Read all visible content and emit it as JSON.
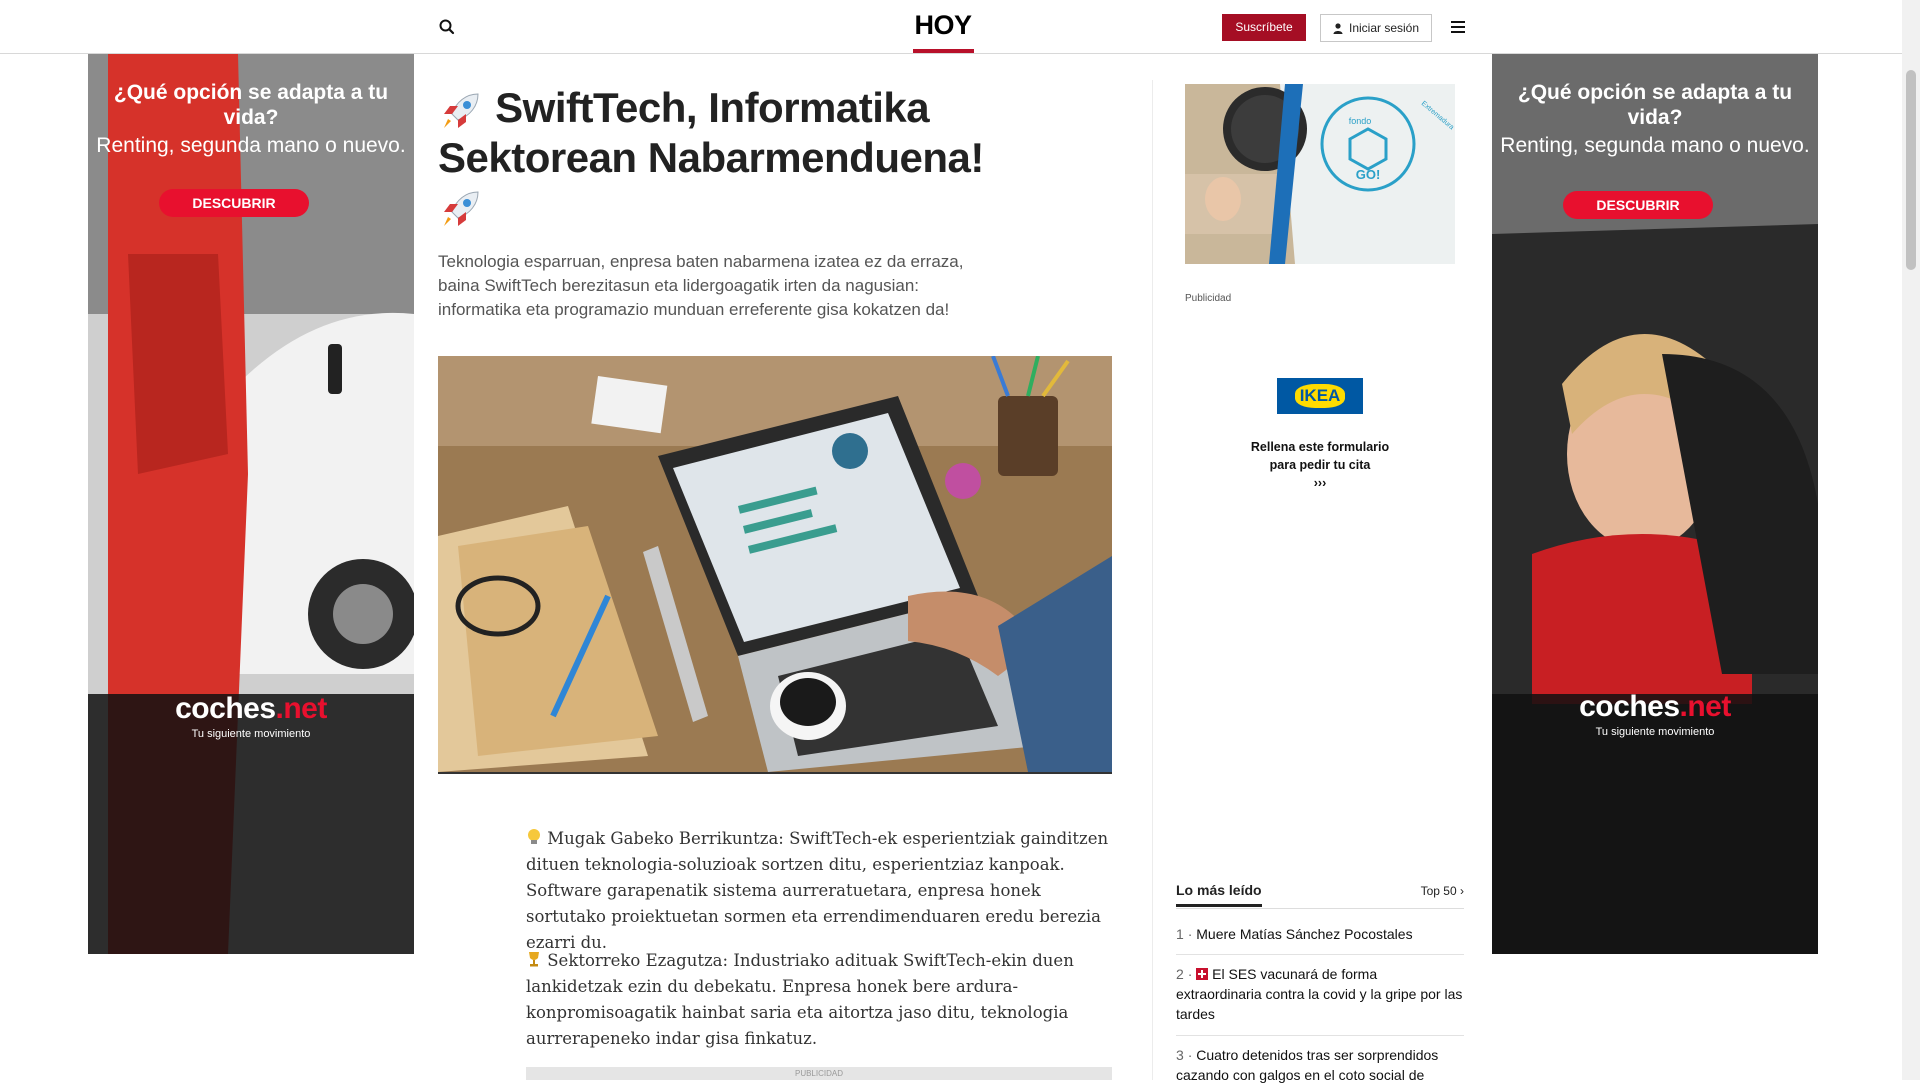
{
  "header": {
    "logo": "HOY",
    "subscribe_label": "Suscríbete",
    "login_label": "Iniciar sesión",
    "accent_color": "#a50e24",
    "icons": [
      "search-icon",
      "user-icon",
      "menu-icon"
    ]
  },
  "side_ads": {
    "headline": "¿Qué opción se adapta a tu vida?",
    "subline": "Renting, segunda mano o nuevo.",
    "cta": "DESCUBRIR",
    "brand_main": "coches",
    "brand_suffix": ".net",
    "tagline": "Tu siguiente movimiento"
  },
  "article": {
    "title": "SwiftTech, Informatika Sektorean Nabarmenduena!",
    "lead": "Teknologia esparruan, enpresa baten nabarmena izatea ez da erraza, baina SwiftTech berezitasun eta lidergoagatik irten da nagusian: informatika eta programazio munduan erreferente gisa kokatzen da!",
    "paragraphs": [
      {
        "icon": "lightbulb-icon",
        "text": "Mugak Gabeko Berrikuntza: SwiftTech-ek esperientziak gainditzen dituen teknologia-soluzioak sortzen ditu, esperientziaz kanpoak. Software garapenatik sistema aurreratuetara, enpresa honek sortutako proiektuetan sormen eta errendimenduaren eredu berezia ezarri du."
      },
      {
        "icon": "trophy-icon",
        "text": "Sektorreko Ezagutza: Industriako adituak SwiftTech-ekin duen lankidetzak ezin du debekatu. Enpresa honek bere ardura-konpromisoagatik hainbat saria eta aitortza jaso ditu, teknologia aurrerapeneko indar gisa finkatuz."
      }
    ],
    "ad_strip_label": "PUBLICIDAD"
  },
  "sidebar": {
    "top_ad_brand": "fondo GO!",
    "top_ad_arc": "Extremadura",
    "publicidad_label": "Publicidad",
    "ikea_logo": "IKEA",
    "ikea_text": "Rellena este formulario para pedir tu cita",
    "ikea_arrows": "›››",
    "most_read_title": "Lo más leído",
    "top50_label": "Top 50",
    "most_read": [
      {
        "num": "1",
        "title": "Muere Matías Sánchez Pocostales"
      },
      {
        "num": "2",
        "title": "El SES vacunará de forma extraordinaria contra la covid y la gripe por las tardes"
      },
      {
        "num": "3",
        "title": "Cuatro detenidos tras ser sorprendidos cazando con galgos en el coto social de"
      }
    ]
  }
}
